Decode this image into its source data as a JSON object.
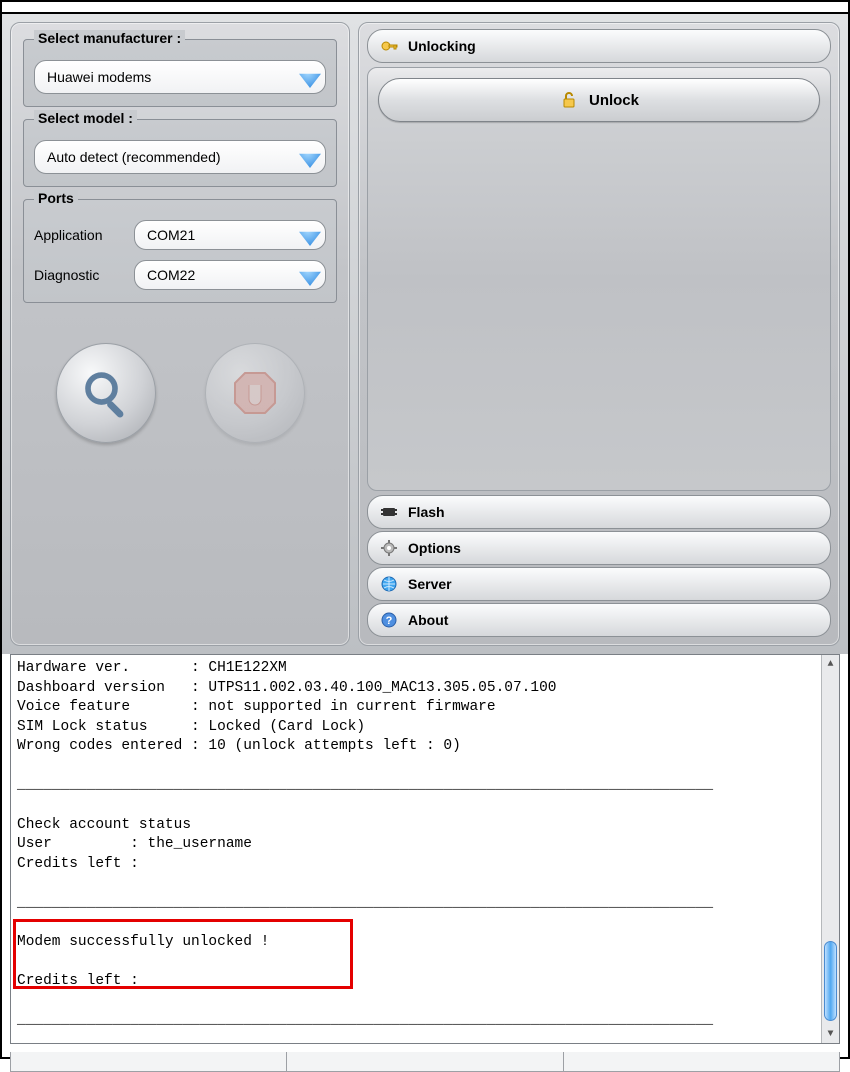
{
  "left": {
    "manufacturer_label": "Select manufacturer :",
    "manufacturer_value": "Huawei modems",
    "model_label": "Select model :",
    "model_value": "Auto detect (recommended)",
    "ports_label": "Ports",
    "port_app_label": "Application",
    "port_app_value": "COM21",
    "port_diag_label": "Diagnostic",
    "port_diag_value": "COM22"
  },
  "accordion": {
    "unlocking": "Unlocking",
    "unlock_btn": "Unlock",
    "flash": "Flash",
    "options": "Options",
    "server": "Server",
    "about": "About"
  },
  "log_text": "Hardware ver.       : CH1E122XM\nDashboard version   : UTPS11.002.03.40.100_MAC13.305.05.07.100\nVoice feature       : not supported in current firmware\nSIM Lock status     : Locked (Card Lock)\nWrong codes entered : 10 (unlock attempts left : 0)\n\n________________________________________________________________________________\n\nCheck account status\nUser         : the_username\nCredits left :\n\n________________________________________________________________________________\n\nModem successfully unlocked !\n\nCredits left :\n\n________________________________________________________________________________\n"
}
